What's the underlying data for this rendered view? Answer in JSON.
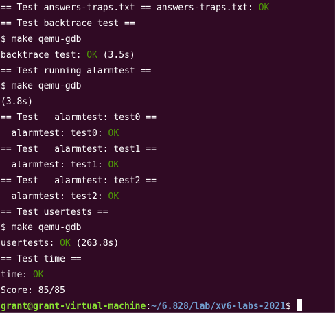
{
  "colors": {
    "background": "#300a24",
    "text": "#ffffff",
    "ok": "#4e9a06",
    "prompt_user": "#8ae234",
    "prompt_path": "#729fcf"
  },
  "terminal": {
    "lines": [
      {
        "pre": "== Test answers-traps.txt == answers-traps.txt: ",
        "ok": "OK",
        "post": ""
      },
      {
        "pre": "== Test backtrace test ==",
        "ok": "",
        "post": ""
      },
      {
        "pre": "$ make qemu-gdb",
        "ok": "",
        "post": ""
      },
      {
        "pre": "backtrace test: ",
        "ok": "OK",
        "post": " (3.5s)"
      },
      {
        "pre": "== Test running alarmtest ==",
        "ok": "",
        "post": ""
      },
      {
        "pre": "$ make qemu-gdb",
        "ok": "",
        "post": ""
      },
      {
        "pre": "(3.8s)",
        "ok": "",
        "post": ""
      },
      {
        "pre": "== Test   alarmtest: test0 ==",
        "ok": "",
        "post": ""
      },
      {
        "pre": "  alarmtest: test0: ",
        "ok": "OK",
        "post": ""
      },
      {
        "pre": "== Test   alarmtest: test1 ==",
        "ok": "",
        "post": ""
      },
      {
        "pre": "  alarmtest: test1: ",
        "ok": "OK",
        "post": ""
      },
      {
        "pre": "== Test   alarmtest: test2 ==",
        "ok": "",
        "post": ""
      },
      {
        "pre": "  alarmtest: test2: ",
        "ok": "OK",
        "post": ""
      },
      {
        "pre": "== Test usertests ==",
        "ok": "",
        "post": ""
      },
      {
        "pre": "$ make qemu-gdb",
        "ok": "",
        "post": ""
      },
      {
        "pre": "usertests: ",
        "ok": "OK",
        "post": " (263.8s)"
      },
      {
        "pre": "== Test time ==",
        "ok": "",
        "post": ""
      },
      {
        "pre": "time: ",
        "ok": "OK",
        "post": ""
      },
      {
        "pre": "Score: 85/85",
        "ok": "",
        "post": ""
      }
    ],
    "prompt": {
      "user_host": "grant@grant-virtual-machine",
      "separator": ":",
      "path": "~/6.828/lab/xv6-labs-2021",
      "symbol": "$ "
    }
  }
}
